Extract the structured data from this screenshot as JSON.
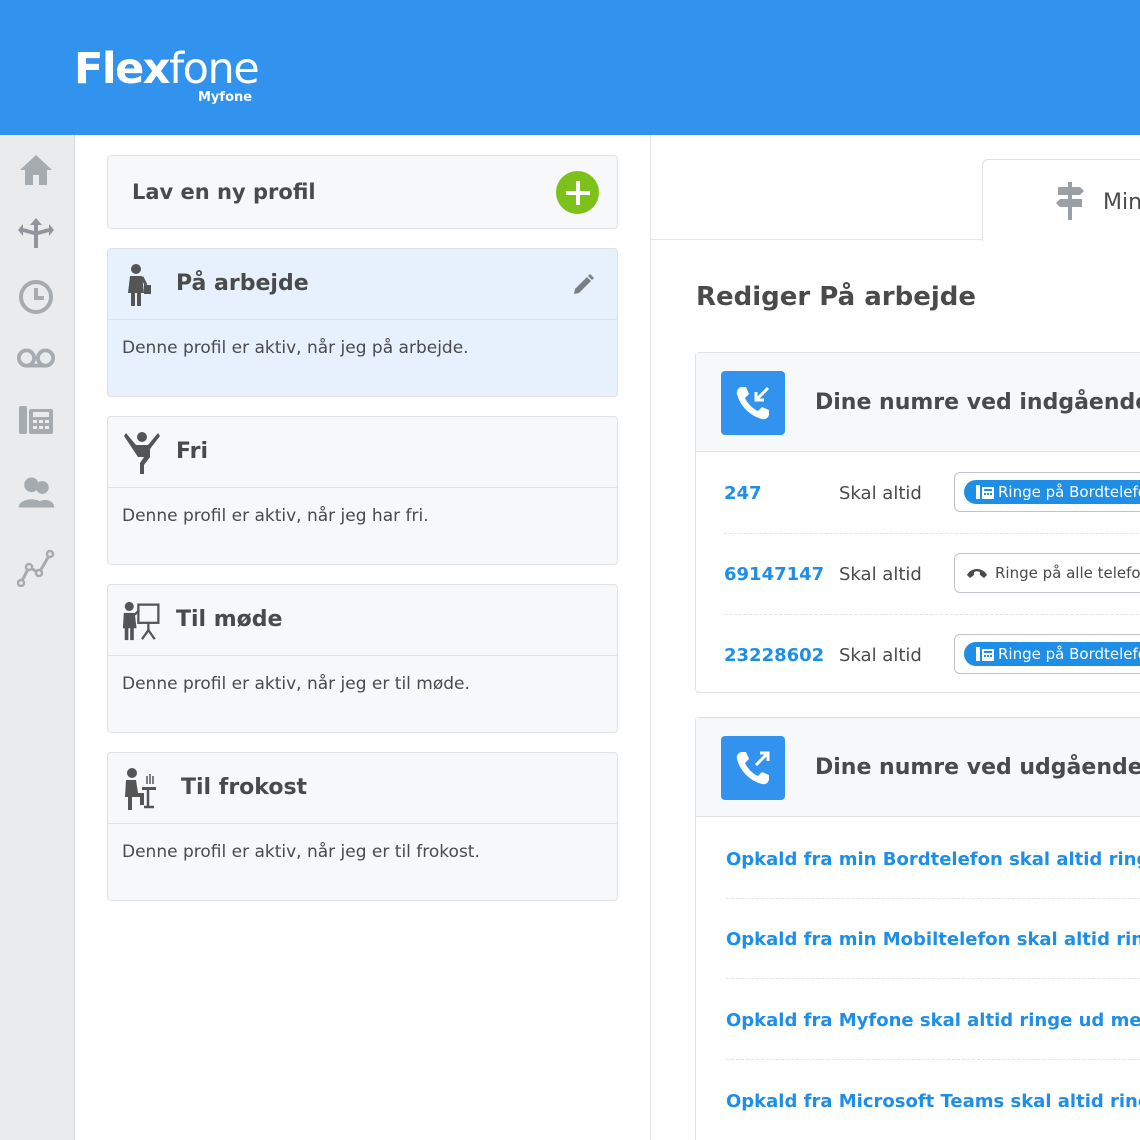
{
  "brand": {
    "name_a": "Flex",
    "name_b": "fone",
    "sub": "Myfone",
    "color": "#3193ee"
  },
  "sidebar": {
    "items": [
      {
        "icon": "home-icon"
      },
      {
        "icon": "routing-icon"
      },
      {
        "icon": "clock-icon"
      },
      {
        "icon": "voicemail-icon"
      },
      {
        "icon": "desk-phone-icon"
      },
      {
        "icon": "contacts-icon"
      },
      {
        "icon": "statistics-icon"
      }
    ]
  },
  "new_profile": {
    "label": "Lav en ny profil"
  },
  "profiles": [
    {
      "name": "På arbejde",
      "desc": "Denne profil er aktiv, når jeg på arbejde.",
      "icon": "working-person-icon",
      "active": true
    },
    {
      "name": "Fri",
      "desc": "Denne profil er aktiv, når jeg har fri.",
      "icon": "free-person-icon"
    },
    {
      "name": "Til møde",
      "desc": "Denne profil er aktiv, når jeg er til møde.",
      "icon": "meeting-person-icon"
    },
    {
      "name": "Til frokost",
      "desc": "Denne profil er aktiv, når jeg er til frokost.",
      "icon": "lunch-person-icon"
    }
  ],
  "tab": {
    "label": "Min",
    "icon": "signpost-icon"
  },
  "edit_title": "Rediger På arbejde",
  "incoming": {
    "title": "Dine numre ved indgående op",
    "rows": [
      {
        "number": "247",
        "rule": "Skal altid",
        "action": "Ringe på Bordtelefon",
        "style": "pill"
      },
      {
        "number": "69147147",
        "rule": "Skal altid",
        "action": "Ringe på alle telefoner",
        "style": "plain"
      },
      {
        "number": "23228602",
        "rule": "Skal altid",
        "action": "Ringe på Bordtelefon",
        "style": "pill"
      }
    ]
  },
  "outgoing": {
    "title": "Dine numre ved udgående opk",
    "rows": [
      "Opkald fra min Bordtelefon skal altid ringe ud m",
      "Opkald fra min Mobiltelefon skal altid ringe ud r",
      "Opkald fra Myfone skal altid ringe ud med",
      "Opkald fra Microsoft Teams skal altid ringe ud m"
    ]
  }
}
